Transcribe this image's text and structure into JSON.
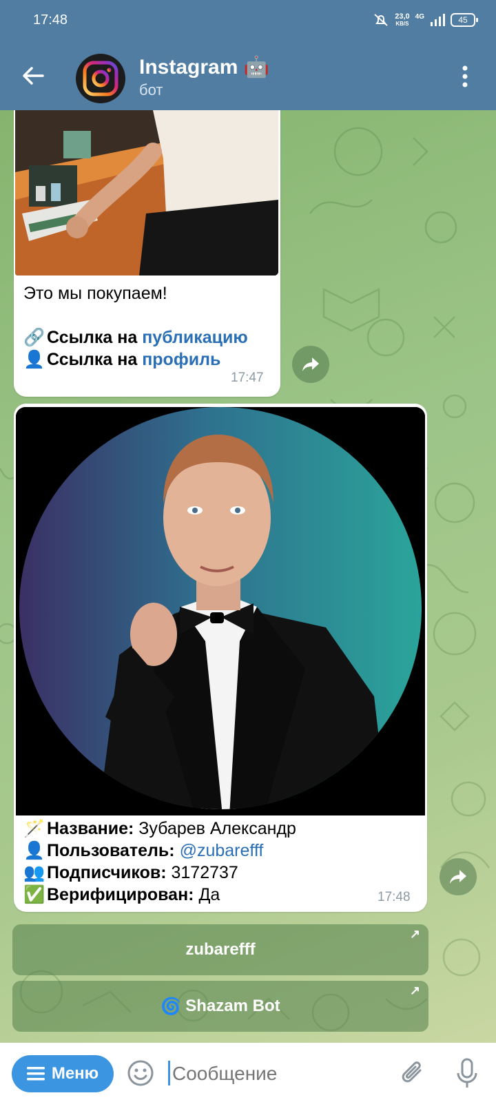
{
  "status_bar": {
    "time": "17:48",
    "net_speed": "23,0",
    "net_unit": "KB/S",
    "network": "4G",
    "battery": "45"
  },
  "header": {
    "title": "Instagram 🤖",
    "subtitle": "бот"
  },
  "messages": [
    {
      "text": "Это мы покупаем!",
      "publication_emoji": "🔗",
      "publication_prefix": "Ссылка на",
      "publication_link": "публикацию",
      "profile_emoji": "👤",
      "profile_prefix": "Ссылка на",
      "profile_link": "профиль",
      "time": "17:47"
    },
    {
      "name_emoji": "🪄",
      "name_label": "Название:",
      "name_value": "Зубарев Александр",
      "user_emoji": "👤",
      "user_label": "Пользователь:",
      "user_value": "@zubarefff",
      "subs_emoji": "👥",
      "subs_label": "Подписчиков:",
      "subs_value": "3172737",
      "verified_emoji": "✅",
      "verified_label": "Верифицирован:",
      "verified_value": "Да",
      "time": "17:48"
    }
  ],
  "inline_buttons": [
    {
      "label": "zubarefff",
      "arrow": "↗"
    },
    {
      "icon": "🌀",
      "label": "Shazam Bot",
      "arrow": "↗"
    }
  ],
  "input_bar": {
    "menu_label": "Меню",
    "placeholder": "Сообщение"
  },
  "colors": {
    "header": "#517da2",
    "accent": "#3b95e0",
    "link": "#2a6fb5"
  }
}
